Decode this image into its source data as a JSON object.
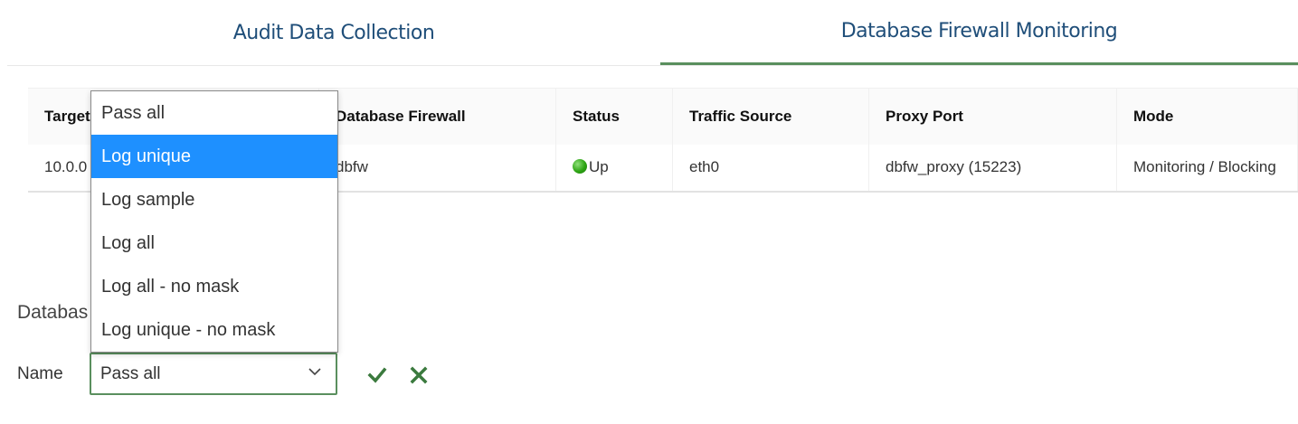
{
  "tabs": [
    {
      "label": "Audit Data Collection",
      "active": false
    },
    {
      "label": "Database Firewall Monitoring",
      "active": true
    }
  ],
  "table": {
    "headers": [
      "Target",
      "Database Firewall",
      "Status",
      "Traffic Source",
      "Proxy Port",
      "Mode"
    ],
    "rows": [
      {
        "target": "10.0.0",
        "firewall": "dbfw",
        "status": "Up",
        "traffic_source": "eth0",
        "proxy_port": "dbfw_proxy (15223)",
        "mode": "Monitoring / Blocking"
      }
    ]
  },
  "section": {
    "title": "Databas"
  },
  "form": {
    "name_label": "Name",
    "select_value": "Pass all",
    "options": [
      "Pass all",
      "Log unique",
      "Log sample",
      "Log all",
      "Log all - no mask",
      "Log unique - no mask"
    ],
    "highlighted_option": "Log unique"
  },
  "colors": {
    "tab_text": "#1f4e79",
    "active_tab_underline": "#5a8f5e",
    "highlight": "#1e90ff",
    "status_up": "#2da414",
    "confirm": "#3b7a3e"
  },
  "icons": [
    "status-up-icon",
    "chevron-down-icon",
    "checkmark-icon",
    "close-icon"
  ]
}
